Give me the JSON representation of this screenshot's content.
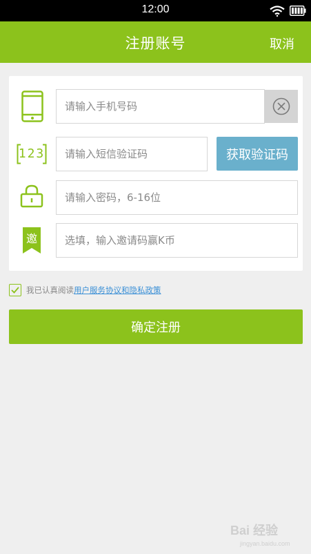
{
  "status_bar": {
    "time": "12:00"
  },
  "header": {
    "title": "注册账号",
    "cancel_label": "取消"
  },
  "form": {
    "phone": {
      "placeholder": "请输入手机号码",
      "value": ""
    },
    "sms_code": {
      "placeholder": "请输入短信验证码",
      "value": "",
      "button_label": "获取验证码",
      "icon_text": "123"
    },
    "password": {
      "placeholder": "请输入密码，6-16位",
      "value": ""
    },
    "invite": {
      "placeholder": "选填，输入邀请码赢K币",
      "value": "",
      "icon_text": "邀"
    }
  },
  "agreement": {
    "checked": true,
    "prefix": "我已认真阅读",
    "link": "用户服务协议和隐私政策"
  },
  "submit_label": "确定注册",
  "watermark": {
    "logo_text": "Bai 经验",
    "url_text": "jingyan.baidu.com"
  },
  "colors": {
    "primary": "#8cc21c",
    "button_blue": "#6ab0cc",
    "background": "#efefef",
    "link": "#3a8fd6"
  }
}
